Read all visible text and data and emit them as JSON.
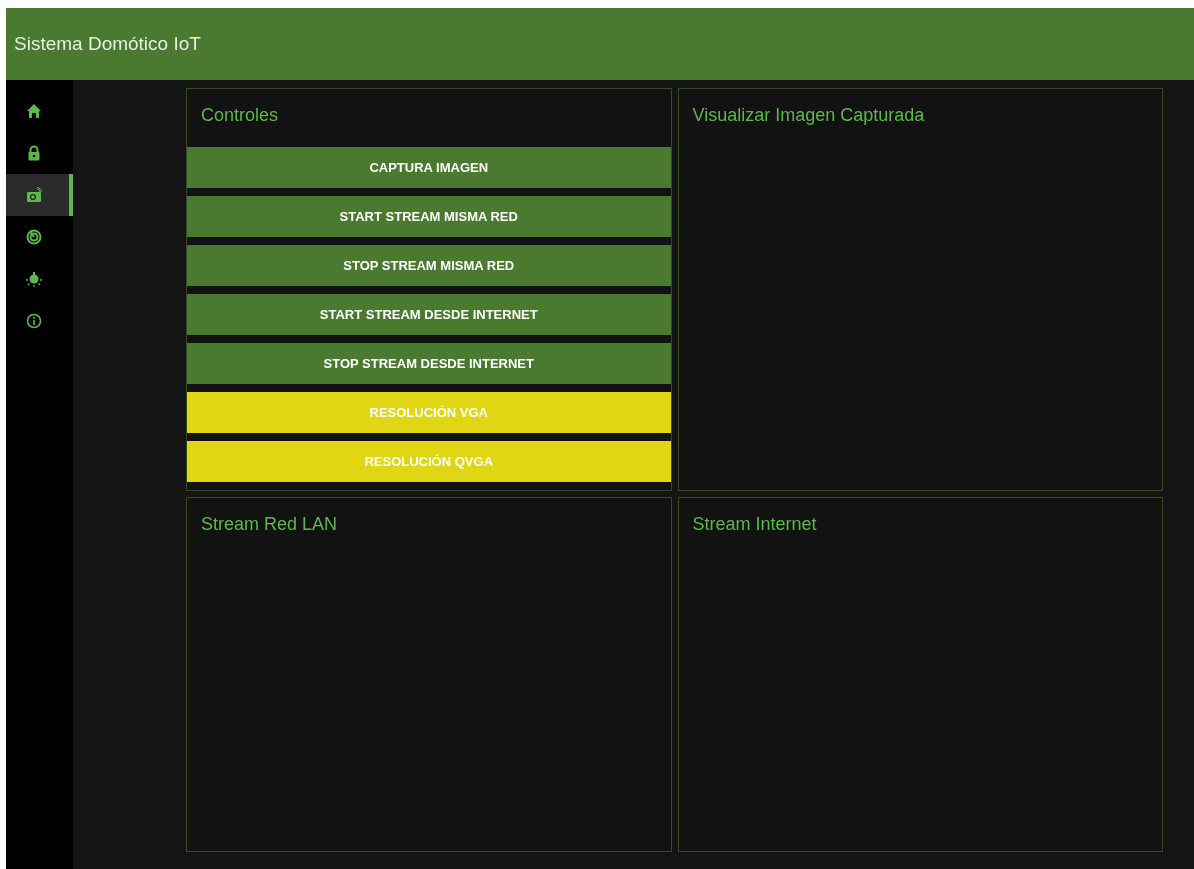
{
  "header": {
    "title": "Sistema Domótico IoT"
  },
  "sidebar": {
    "items": [
      {
        "selected": false
      },
      {
        "selected": false
      },
      {
        "selected": true
      },
      {
        "selected": false
      },
      {
        "selected": false
      },
      {
        "selected": false
      }
    ]
  },
  "panels": [
    {
      "title": "Controles",
      "buttons": [
        {
          "label": "CAPTURA IMAGEN",
          "color": "#4a7a30"
        },
        {
          "label": "START STREAM MISMA RED",
          "color": "#4a7a30"
        },
        {
          "label": "STOP STREAM MISMA RED",
          "color": "#4a7a30"
        },
        {
          "label": "START STREAM DESDE INTERNET",
          "color": "#4a7a30"
        },
        {
          "label": "STOP STREAM DESDE INTERNET",
          "color": "#4a7a30"
        },
        {
          "label": "RESOLUCIÓN VGA",
          "color": "#e0d614"
        },
        {
          "label": "RESOLUCIÓN QVGA",
          "color": "#e0d614"
        }
      ]
    },
    {
      "title": "Visualizar Imagen Capturada"
    },
    {
      "title": "Stream Red LAN"
    },
    {
      "title": "Stream Internet"
    }
  ]
}
